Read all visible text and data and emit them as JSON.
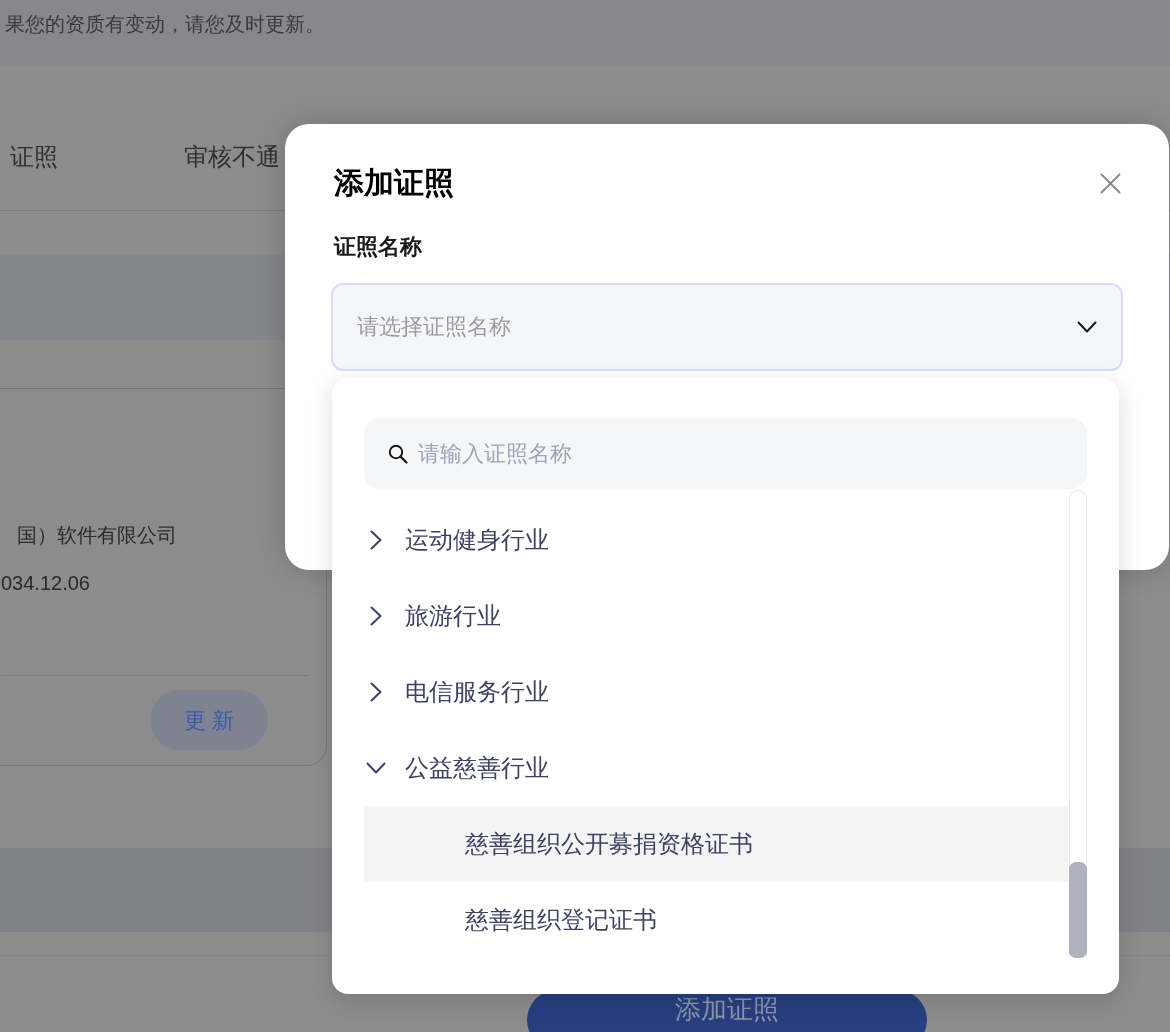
{
  "page": {
    "notice": "果您的资质有变动，请您及时更新。",
    "tabs": [
      {
        "label": "证照",
        "selected": false
      },
      {
        "label": "审核不通",
        "selected": false
      }
    ],
    "license_card": {
      "company": "国）软件有限公司",
      "expiry": "034.12.06",
      "update_button": "更 新"
    },
    "add_button": "添加证照"
  },
  "dialog": {
    "title": "添加证照",
    "field_label": "证照名称",
    "select": {
      "placeholder": "请选择证照名称",
      "focused": true
    },
    "dropdown": {
      "search": {
        "placeholder": "请输入证照名称"
      },
      "tree": [
        {
          "label": "运动健身行业",
          "expanded": false
        },
        {
          "label": "旅游行业",
          "expanded": false
        },
        {
          "label": "电信服务行业",
          "expanded": false
        },
        {
          "label": "公益慈善行业",
          "expanded": true,
          "children": [
            {
              "label": "慈善组织公开募捐资格证书",
              "highlighted": true
            },
            {
              "label": "慈善组织登记证书",
              "highlighted": false
            }
          ]
        }
      ]
    }
  }
}
